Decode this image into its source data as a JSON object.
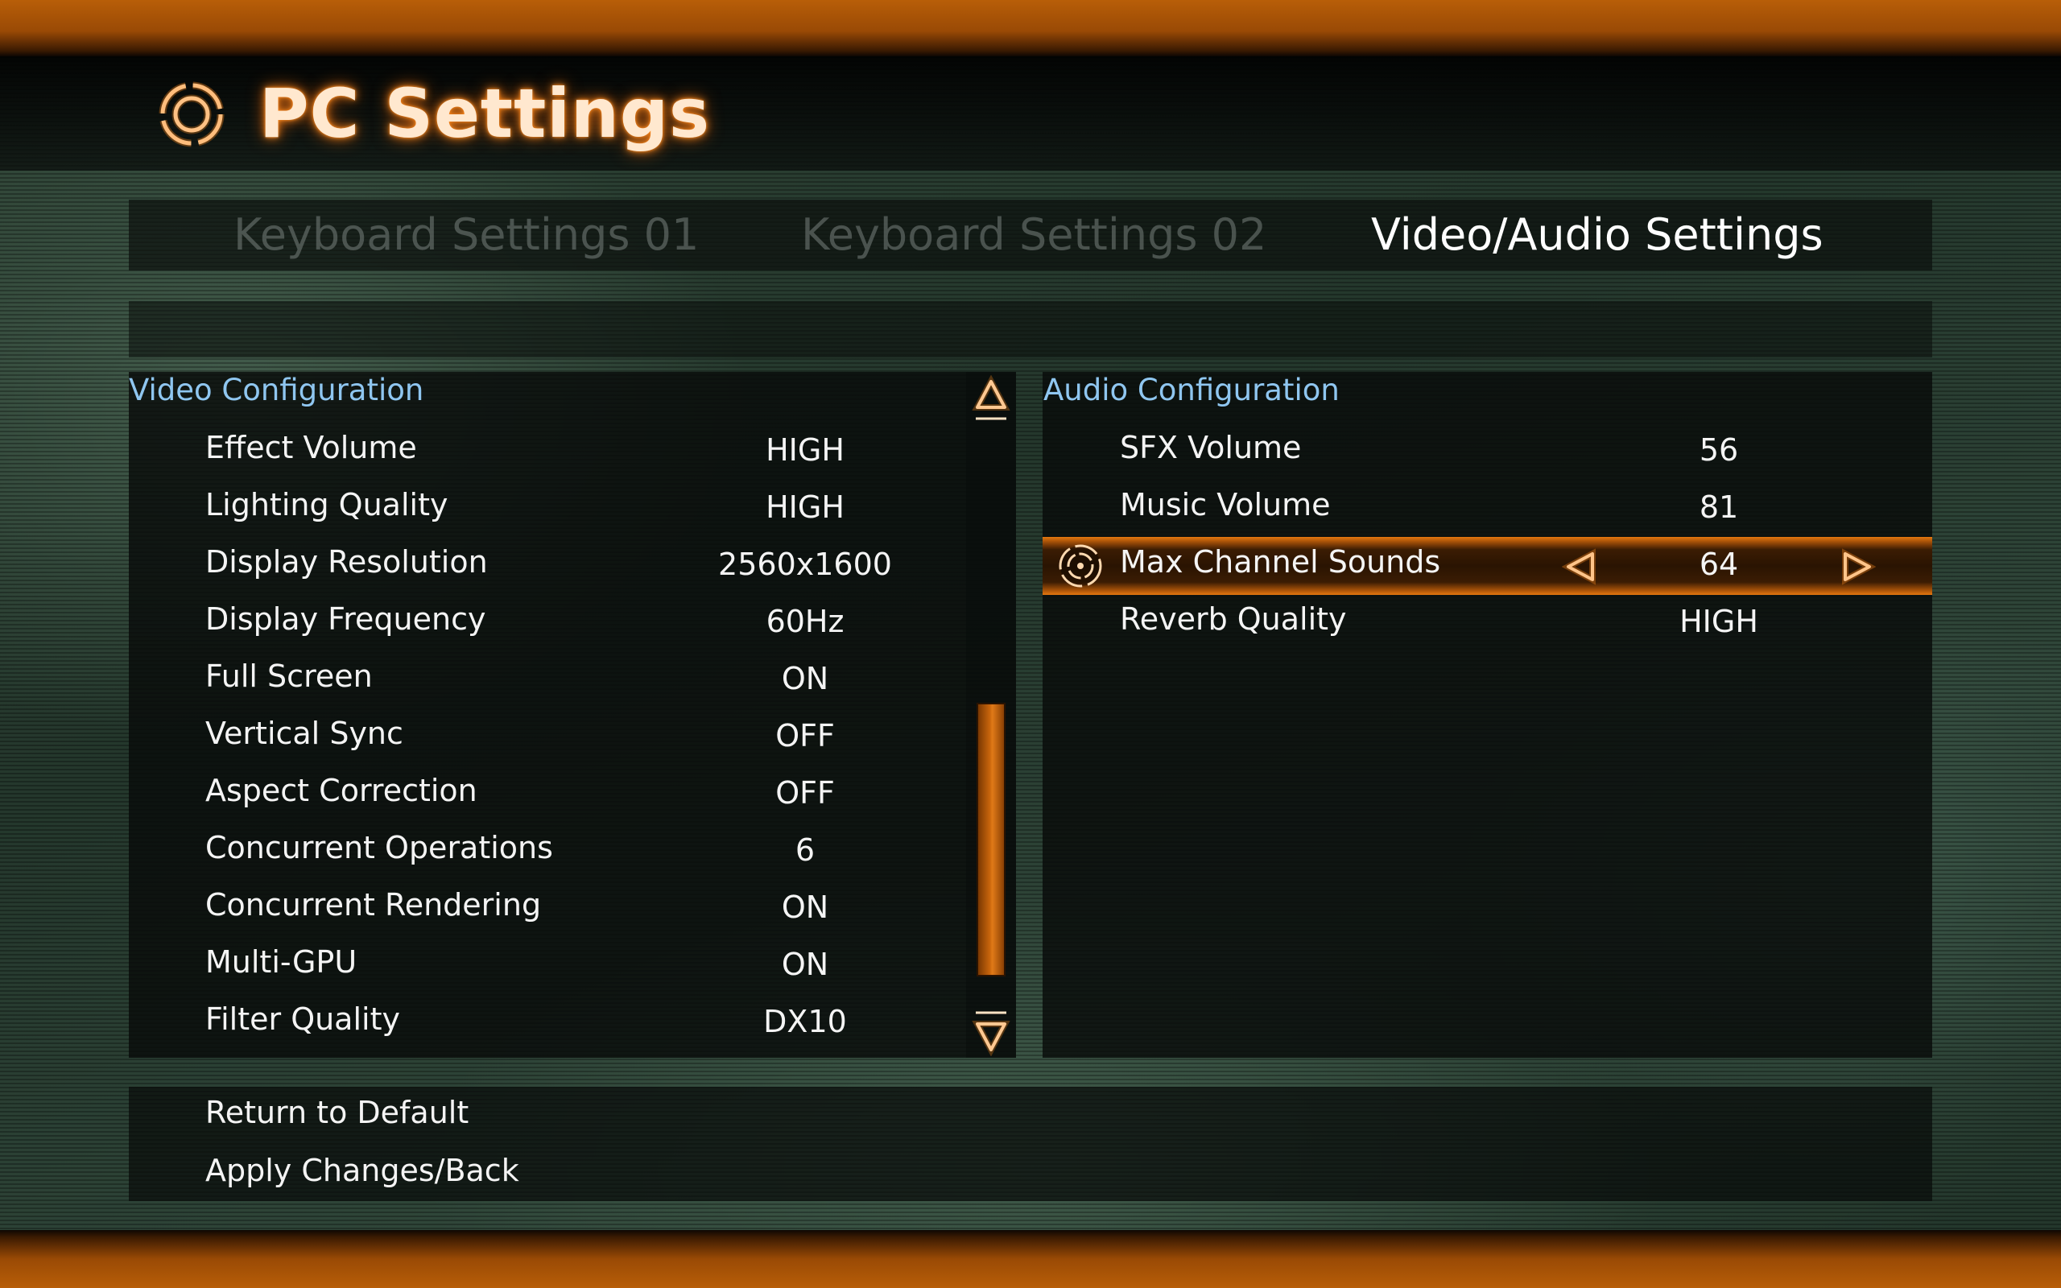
{
  "header": {
    "title": "PC Settings",
    "icon": "gear-ring-icon"
  },
  "tabs": [
    {
      "label": "Keyboard Settings 01",
      "active": false
    },
    {
      "label": "Keyboard Settings 02",
      "active": false
    },
    {
      "label": "Video/Audio Settings",
      "active": true
    }
  ],
  "video": {
    "title": "Video Configuration",
    "rows": [
      {
        "label": "Effect Volume",
        "value": "HIGH"
      },
      {
        "label": "Lighting Quality",
        "value": "HIGH"
      },
      {
        "label": "Display Resolution",
        "value": "2560x1600"
      },
      {
        "label": "Display Frequency",
        "value": "60Hz"
      },
      {
        "label": "Full Screen",
        "value": "ON"
      },
      {
        "label": "Vertical Sync",
        "value": "OFF"
      },
      {
        "label": "Aspect Correction",
        "value": "OFF"
      },
      {
        "label": "Concurrent Operations",
        "value": "6"
      },
      {
        "label": "Concurrent Rendering",
        "value": "ON"
      },
      {
        "label": "Multi-GPU",
        "value": "ON"
      },
      {
        "label": "Filter Quality",
        "value": "DX10"
      }
    ]
  },
  "audio": {
    "title": "Audio Configuration",
    "rows": [
      {
        "label": "SFX Volume",
        "value": "56"
      },
      {
        "label": "Music Volume",
        "value": "81"
      },
      {
        "label": "Max Channel Sounds",
        "value": "64",
        "selected": true
      },
      {
        "label": "Reverb Quality",
        "value": "HIGH"
      }
    ]
  },
  "actions": {
    "return_default": "Return to Default",
    "apply_back": "Apply Changes/Back"
  },
  "colors": {
    "accent_orange": "#c8650c",
    "section_title": "#8fc6f0",
    "text": "#f4f4f4"
  }
}
